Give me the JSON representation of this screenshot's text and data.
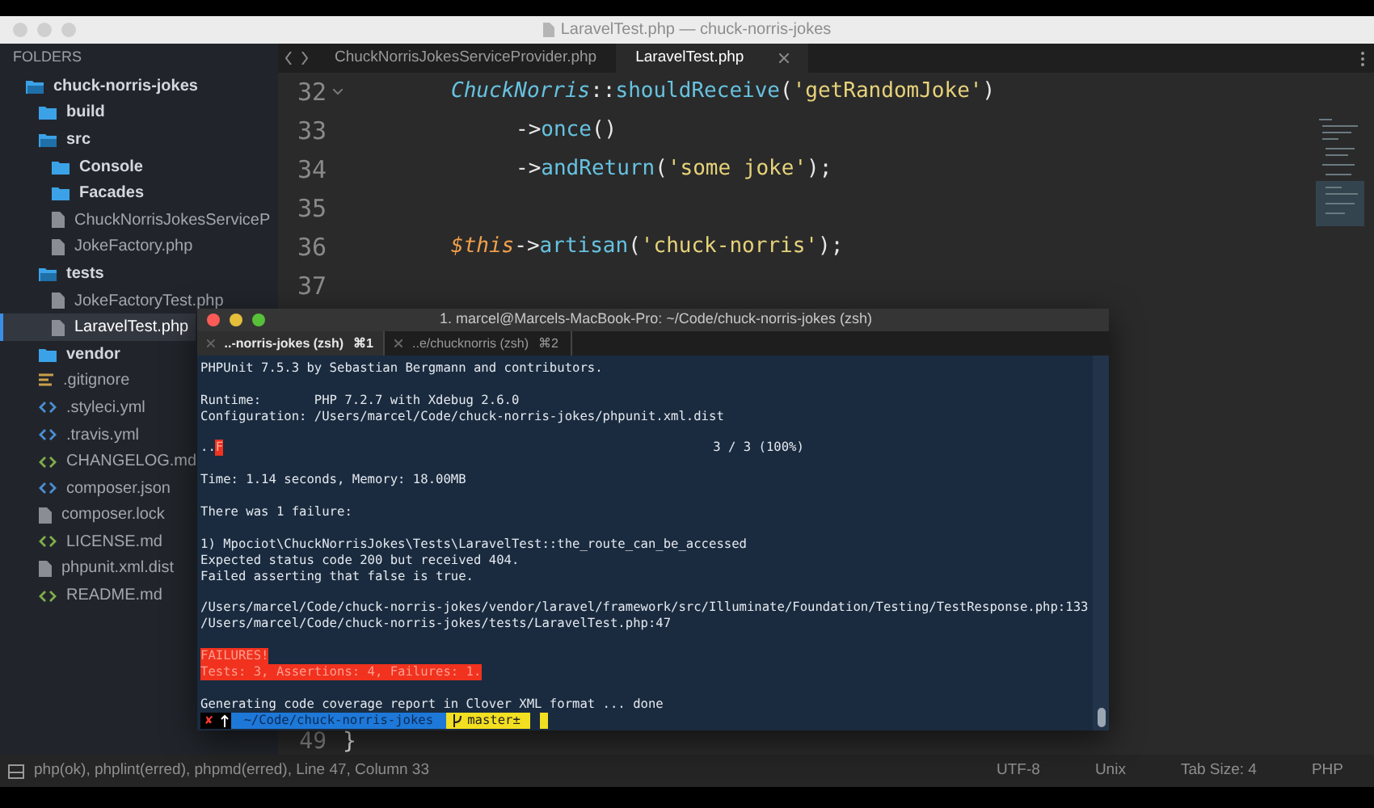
{
  "window": {
    "title": "LaravelTest.php — chuck-norris-jokes"
  },
  "sidebar": {
    "header": "FOLDERS",
    "items": [
      {
        "kind": "folder",
        "name": "chuck-norris-jokes",
        "expanded": true,
        "selected": false,
        "children": [
          {
            "kind": "folder",
            "name": "build",
            "expanded": false,
            "selected": false
          },
          {
            "kind": "folder",
            "name": "src",
            "expanded": true,
            "selected": false,
            "children": [
              {
                "kind": "folder",
                "name": "Console",
                "expanded": false,
                "selected": false
              },
              {
                "kind": "folder",
                "name": "Facades",
                "expanded": false,
                "selected": false
              },
              {
                "kind": "file",
                "name": "ChuckNorrisJokesServiceP",
                "selected": false
              },
              {
                "kind": "file",
                "name": "JokeFactory.php",
                "selected": false
              }
            ]
          },
          {
            "kind": "folder",
            "name": "tests",
            "expanded": true,
            "selected": false,
            "children": [
              {
                "kind": "file",
                "name": "JokeFactoryTest.php",
                "selected": false
              },
              {
                "kind": "file",
                "name": "LaravelTest.php",
                "selected": true
              }
            ]
          },
          {
            "kind": "folder",
            "name": "vendor",
            "expanded": false,
            "selected": false
          },
          {
            "kind": "lines",
            "name": ".gitignore",
            "selected": false
          },
          {
            "kind": "link",
            "name": ".styleci.yml",
            "selected": false
          },
          {
            "kind": "link",
            "name": ".travis.yml",
            "selected": false
          },
          {
            "kind": "markup",
            "name": "CHANGELOG.md",
            "selected": false
          },
          {
            "kind": "link",
            "name": "composer.json",
            "selected": false
          },
          {
            "kind": "file",
            "name": "composer.lock",
            "selected": false
          },
          {
            "kind": "markup",
            "name": "LICENSE.md",
            "selected": false
          },
          {
            "kind": "file",
            "name": "phpunit.xml.dist",
            "selected": false
          },
          {
            "kind": "markup",
            "name": "README.md",
            "selected": false
          }
        ]
      }
    ]
  },
  "editor": {
    "tabs": [
      {
        "label": "ChuckNorrisJokesServiceProvider.php",
        "selected": false
      },
      {
        "label": "LaravelTest.php",
        "selected": true
      }
    ],
    "lines": [
      {
        "number": "32",
        "foldable": true,
        "segments": [
          {
            "kind": "class",
            "text": "ChuckNorris"
          },
          {
            "kind": "plain",
            "text": "::"
          },
          {
            "kind": "fn",
            "text": "shouldReceive"
          },
          {
            "kind": "plain",
            "text": "("
          },
          {
            "kind": "str",
            "text": "'getRandomJoke'"
          },
          {
            "kind": "plain",
            "text": ")"
          }
        ],
        "children": [
          {
            "number": "33",
            "segments": [
              {
                "kind": "plain",
                "text": "->"
              },
              {
                "kind": "fn",
                "text": "once"
              },
              {
                "kind": "plain",
                "text": "()"
              }
            ]
          },
          {
            "number": "34",
            "segments": [
              {
                "kind": "plain",
                "text": "->"
              },
              {
                "kind": "fn",
                "text": "andReturn"
              },
              {
                "kind": "plain",
                "text": "("
              },
              {
                "kind": "str",
                "text": "'some joke'"
              },
              {
                "kind": "plain",
                "text": ");"
              }
            ]
          }
        ]
      },
      {
        "number": "35"
      },
      {
        "number": "36",
        "segments": [
          {
            "kind": "var",
            "text": "$this"
          },
          {
            "kind": "plain",
            "text": "->"
          },
          {
            "kind": "fn",
            "text": "artisan"
          },
          {
            "kind": "plain",
            "text": "("
          },
          {
            "kind": "str",
            "text": "'chuck-norris'"
          },
          {
            "kind": "plain",
            "text": ");"
          }
        ]
      },
      {
        "number": "37"
      }
    ],
    "last_line": {
      "number": "49",
      "text": "}"
    }
  },
  "terminal": {
    "title": "1. marcel@Marcels-MacBook-Pro: ~/Code/chuck-norris-jokes (zsh)",
    "tabs": [
      {
        "label": "..-norris-jokes (zsh)",
        "shortcut": "⌘1",
        "selected": true
      },
      {
        "label": "..e/chucknorris (zsh)",
        "shortcut": "⌘2",
        "selected": false
      }
    ],
    "lines": [
      {
        "kind": "text",
        "text": "PHPUnit 7.5.3 by Sebastian Bergmann and contributors."
      },
      {
        "kind": "gap"
      },
      {
        "kind": "text",
        "text": "Runtime:       PHP 7.2.7 with Xdebug 2.6.0"
      },
      {
        "kind": "text",
        "text": "Configuration: /Users/marcel/Code/chuck-norris-jokes/phpunit.xml.dist"
      },
      {
        "kind": "gap"
      },
      {
        "kind": "progress",
        "text": "..",
        "mark": "F",
        "count": "3 / 3 (100%)"
      },
      {
        "kind": "gap"
      },
      {
        "kind": "text",
        "text": "Time: 1.14 seconds, Memory: 18.00MB"
      },
      {
        "kind": "gap"
      },
      {
        "kind": "text",
        "text": "There was 1 failure:"
      },
      {
        "kind": "gap"
      },
      {
        "kind": "text",
        "text": "1) Mpociot\\ChuckNorrisJokes\\Tests\\LaravelTest::the_route_can_be_accessed"
      },
      {
        "kind": "text",
        "text": "Expected status code 200 but received 404."
      },
      {
        "kind": "text",
        "text": "Failed asserting that false is true."
      },
      {
        "kind": "gap"
      },
      {
        "kind": "text",
        "text": "/Users/marcel/Code/chuck-norris-jokes/vendor/laravel/framework/src/Illuminate/Foundation/Testing/TestResponse.php:133"
      },
      {
        "kind": "text",
        "text": "/Users/marcel/Code/chuck-norris-jokes/tests/LaravelTest.php:47"
      },
      {
        "kind": "gap"
      },
      {
        "kind": "alert",
        "text": "FAILURES!"
      },
      {
        "kind": "alert",
        "text": "Tests: 3, Assertions: 4, Failures: 1."
      },
      {
        "kind": "gap"
      },
      {
        "kind": "text",
        "text": "Generating code coverage report in Clover XML format ... done"
      }
    ],
    "prompt": {
      "status": "✘",
      "path": "~/Code/chuck-norris-jokes",
      "branch": "master±"
    }
  },
  "status_bar": {
    "left": "php(ok), phplint(erred), phpmd(erred), Line 47, Column 33",
    "right": [
      "UTF-8",
      "Unix",
      "Tab Size: 4",
      "PHP"
    ]
  }
}
